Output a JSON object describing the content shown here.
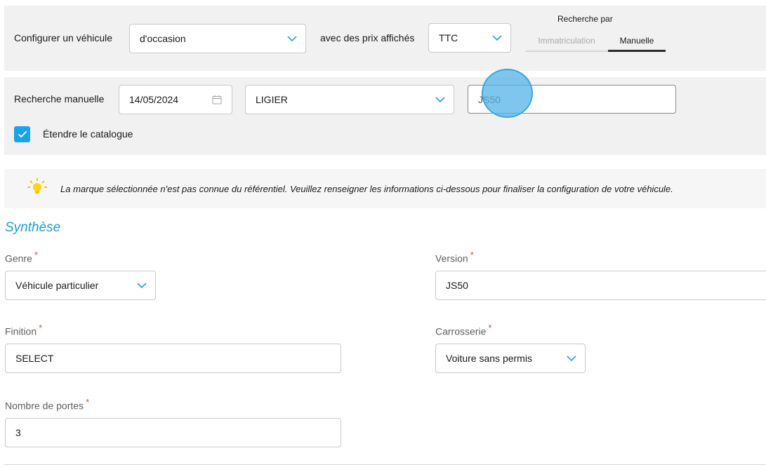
{
  "config": {
    "label": "Configurer un véhicule",
    "vehicle_state": "d'occasion",
    "price_label": "avec des prix affichés",
    "price_mode": "TTC",
    "search_by_title": "Recherche par",
    "tabs": [
      {
        "label": "Immatriculation",
        "active": false
      },
      {
        "label": "Manuelle",
        "active": true
      }
    ]
  },
  "manual_search": {
    "label": "Recherche manuelle",
    "date": "14/05/2024",
    "brand": "LIGIER",
    "model": "JS50",
    "extend_catalog_label": "Étendre le catalogue",
    "extend_catalog_checked": true
  },
  "info": {
    "message": "La marque sélectionnée n'est pas connue du référentiel. Veuillez renseigner les informations ci-dessous pour finaliser la configuration de votre véhicule."
  },
  "synthese": {
    "title": "Synthèse",
    "required_mark": "*",
    "genre": {
      "label": "Genre",
      "value": "Véhicule particulier"
    },
    "version": {
      "label": "Version",
      "value": "JS50"
    },
    "finition": {
      "label": "Finition",
      "value": "SELECT"
    },
    "carrosserie": {
      "label": "Carrosserie",
      "value": "Voiture sans permis"
    },
    "portes": {
      "label": "Nombre de portes",
      "value": "3"
    }
  },
  "colors": {
    "accent": "#1aa3e8",
    "panel_bg": "#f1f1f1",
    "required": "#e04a4a"
  }
}
